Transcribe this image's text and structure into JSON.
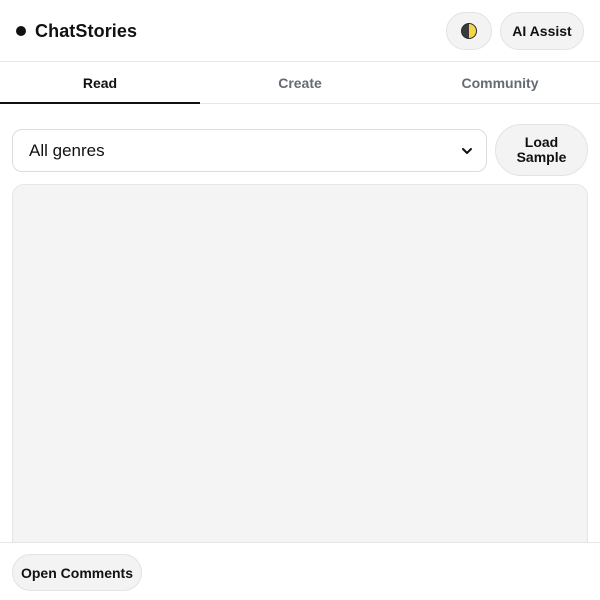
{
  "app": {
    "name": "ChatStories"
  },
  "header": {
    "theme_toggle_icon": "half-moon-theme-icon",
    "ai_assist_label": "AI Assist"
  },
  "tabs": [
    {
      "label": "Read",
      "active": true
    },
    {
      "label": "Create",
      "active": false
    },
    {
      "label": "Community",
      "active": false
    }
  ],
  "controls": {
    "genre_select": {
      "value": "All genres",
      "icon": "chevron-down-icon"
    },
    "load_sample_label": "Load Sample"
  },
  "footer": {
    "open_comments_label": "Open Comments"
  },
  "colors": {
    "background": "#ffffff",
    "button_bg": "#f3f3f3",
    "panel_bg": "#f4f4f4",
    "text_primary": "#111111",
    "text_muted": "#666b73",
    "border": "#e6e6e6",
    "theme_icon_dark": "#3a3a3a",
    "theme_icon_light": "#f2d64a"
  }
}
